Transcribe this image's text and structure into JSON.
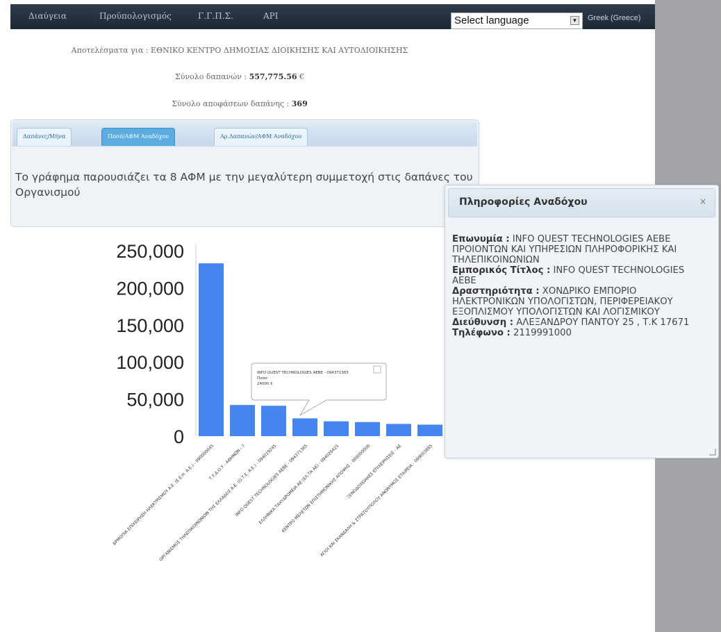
{
  "nav": {
    "items": [
      "Διαύγεια",
      "Προϋπολογισμός",
      "Γ.Γ.Π.Σ.",
      "API"
    ],
    "language_select": "Select language",
    "language_current": "Greek (Greece)"
  },
  "results": {
    "entity_label": "Αποτελέσματα για :",
    "entity": "ΕΘΝΙΚΟ ΚΕΝΤΡΟ ΔΗΜΟΣΙΑΣ ΔΙΟΙΚΗΣΗΣ ΚΑΙ ΑΥΤΟΔΙΟΙΚΗΣΗΣ",
    "total_label": "Σύνολο δαπανών :",
    "total_value": "557,775.56",
    "total_unit": "€",
    "decisions_label": "Σύνολο αποφάσεων δαπάνης :",
    "decisions_value": "369"
  },
  "tabs": [
    "Δαπάνες/Μήνα",
    "Ποσό/ΑΦΜ Αναδόχου",
    "Αρ.Δαπανών/ΑΦΜ Αναδόχου"
  ],
  "chart_description": "Το γράφημα παρουσιάζει τα 8 ΑΦΜ με την μεγαλύτερη συμμετοχή στις δαπάνες του Οργανισμού",
  "chart_data": {
    "type": "bar",
    "categories": [
      "ΕΡΜΟΠΙΑ ΕΠΙΧΕΙΡΗΣΗ ΗΛΕΚΤΡΙΣΜΟΥ Α.Ε. (Ε.Ε.Η. Α.Ε.) - 090000045",
      "Τ.Υ.Δ.Ο.Υ - ΑΘΗΝΩΝ - 7",
      "ΟΡΓΑΝΙΣΜΟΣ ΤΗΛΕΠΙΚΟΙΝΩΝΙΩΝ ΤΗΣ ΕΛΛΑΔΟΣ Α.Ε. (Ο.Τ.Ε. Α.Ε.) - 094019245",
      "INFO QUEST TECHNOLOGIES ΑΕΒΕ - 094371365",
      "ΕΛΛΗΝΙΚΑ ΤΑΧΥΔΡΟΜΕΙΑ ΑΕ (ΕΛ.ΤΑ ΑΕ) - 094026421",
      "ΚΕΝΤΡΟ ΜΕΛΕΤΩΝ ΕΠΙΣΤΗΜΟΝΙΚΗΣ ΑΠΟΨΗΣ - 000000000",
      "ΞΕΝΟΔΟΧΕΙΑΚΕΣ ΕΠΙΧΕΙΡΗΣΕΙΣ - ΑΕ",
      "ΑΓΙΟΙ ΚΑΙ ΣΚΑΝΔΑΛΗ & ΣΤΡΑΤΟΥΠΟΛΟΥ ΑΝΩΝΥΜΟΣ ΕΤΑΙΡΕΙΑ - 099003885"
    ],
    "values": [
      233000,
      42000,
      41000,
      24000,
      20000,
      19000,
      16500,
      15500
    ],
    "ylim": [
      0,
      250000
    ],
    "yticks": [
      0,
      50000,
      100000,
      150000,
      200000,
      250000
    ],
    "ytick_labels": [
      "0",
      "50,000",
      "100,000",
      "150,000",
      "200,000",
      "250,000"
    ],
    "bar_color": "#4585f0",
    "tooltip": {
      "line1": "INFO QUEST TECHNOLOGIES ΑΕΒΕ - 094371365",
      "line2": "Ποσό:",
      "line3": "24000 €"
    }
  },
  "dialog": {
    "title": "Πληροφορίες Αναδόχου",
    "close": "×",
    "fields": [
      {
        "label": "Επωνυμία :",
        "value": "INFO QUEST TECHNOLOGIES ΑΕΒΕ ΠΡΟΙΟΝΤΩΝ ΚΑΙ ΥΠΗΡΕΣΙΩΝ ΠΛΗΡΟΦΟΡΙΚΗΣ ΚΑΙ ΤΗΛΕΠΙΚΟΙΝΩΝΙΩΝ"
      },
      {
        "label": "Εμπορικός Τίτλος :",
        "value": "INFO QUEST TECHNOLOGIES ΑΕΒΕ"
      },
      {
        "label": "Δραστηριότητα :",
        "value": "ΧΟΝΔΡΙΚΟ ΕΜΠΟΡΙΟ ΗΛΕΚΤΡΟΝΙΚΩΝ ΥΠΟΛΟΓΙΣΤΩΝ, ΠΕΡΙΦΕΡΕΙΑΚΟΥ ΕΞΟΠΛΙΣΜΟΥ ΥΠΟΛΟΓΙΣΤΩΝ ΚΑΙ ΛΟΓΙΣΜΙΚΟΥ"
      },
      {
        "label": "Διεύθυνση :",
        "value": "ΑΛΕΞΑΝΔΡΟΥ ΠΑΝΤΟΥ 25 , Τ.Κ 17671"
      },
      {
        "label": "Τηλέφωνο :",
        "value": "2119991000"
      }
    ]
  }
}
